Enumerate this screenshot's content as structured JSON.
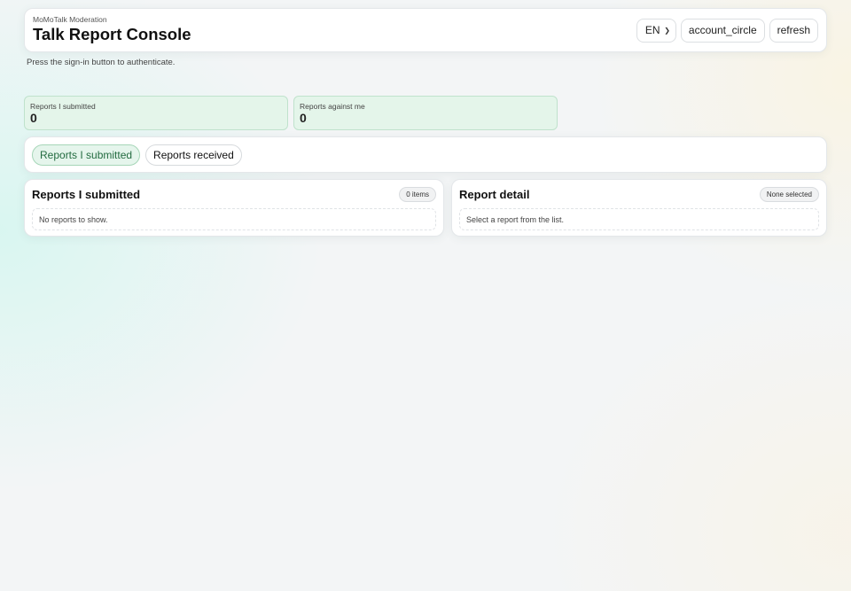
{
  "header": {
    "eyebrow": "MoMoTalk Moderation",
    "title": "Talk Report Console",
    "language": "EN",
    "account_label": "account_circle",
    "refresh_label": "refresh"
  },
  "hint": "Press the sign-in button to authenticate.",
  "stats": [
    {
      "label": "Reports I submitted",
      "value": "0"
    },
    {
      "label": "Reports against me",
      "value": "0"
    }
  ],
  "tabs": [
    {
      "label": "Reports I submitted",
      "active": true
    },
    {
      "label": "Reports received",
      "active": false
    }
  ],
  "list_panel": {
    "title": "Reports I submitted",
    "badge": "0 items",
    "empty_text": "No reports to show."
  },
  "detail_panel": {
    "title": "Report detail",
    "badge": "None selected",
    "empty_text": "Select a report from the list."
  },
  "colors": {
    "accent_green": "#236b40",
    "stat_background": "#e4f5ea",
    "tab_active_background": "#e5f5ec"
  }
}
